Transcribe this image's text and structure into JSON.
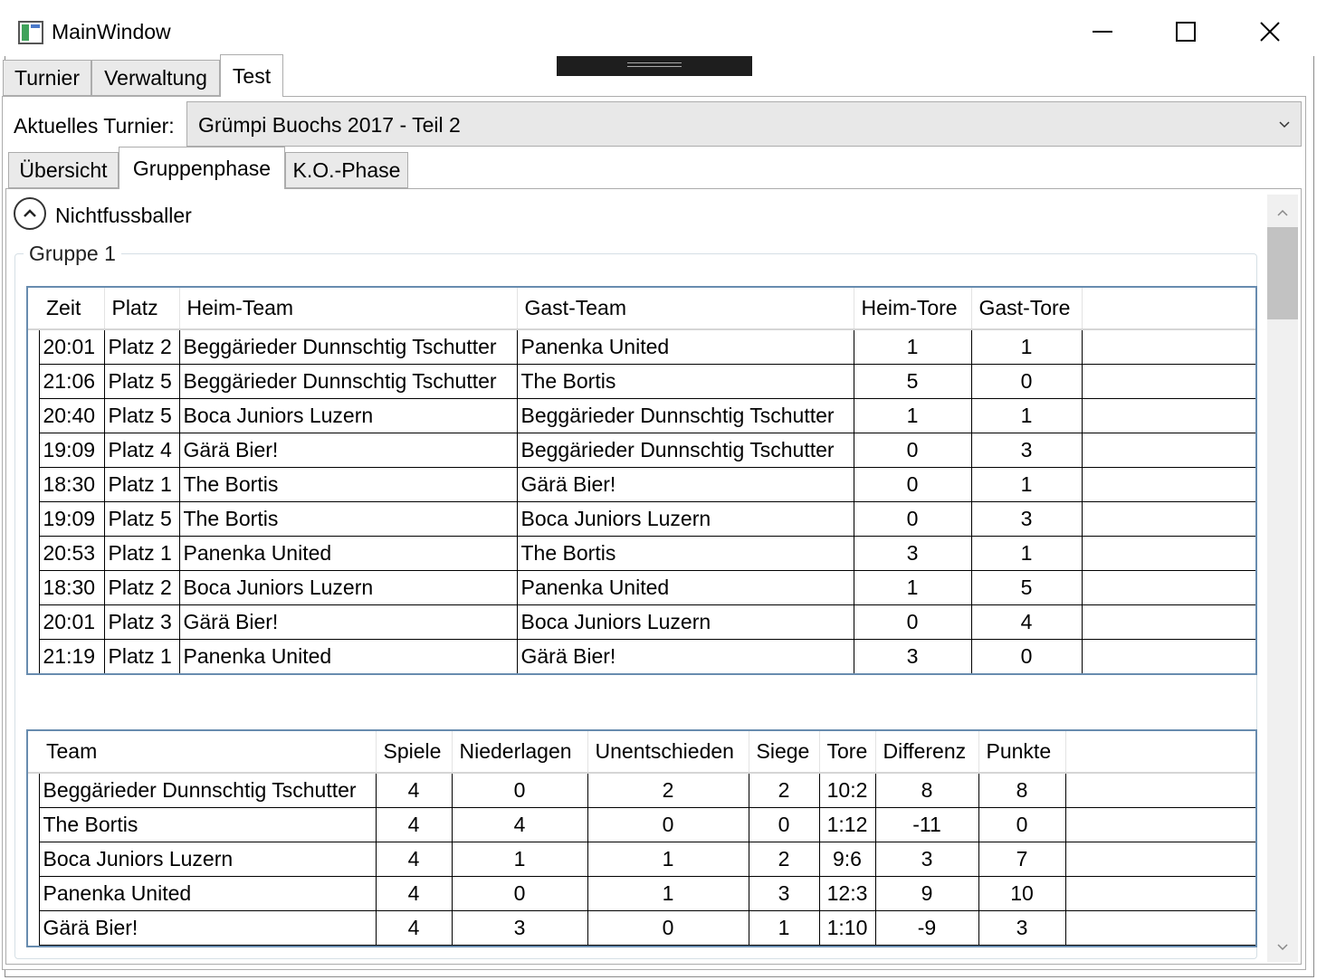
{
  "window": {
    "title": "MainWindow"
  },
  "main_tabs": [
    "Turnier",
    "Verwaltung",
    "Test"
  ],
  "tournament": {
    "label": "Aktuelles Turnier:",
    "selected": "Grümpi Buochs 2017 - Teil 2"
  },
  "sub_tabs": [
    "Übersicht",
    "Gruppenphase",
    "K.O.-Phase"
  ],
  "category": "Nichtfussballer",
  "group": {
    "title": "Gruppe 1",
    "matches": {
      "columns": [
        "Zeit",
        "Platz",
        "Heim-Team",
        "Gast-Team",
        "Heim-Tore",
        "Gast-Tore"
      ],
      "rows": [
        [
          "20:01",
          "Platz 2",
          "Beggärieder Dunnschtig Tschutter",
          "Panenka United",
          "1",
          "1"
        ],
        [
          "21:06",
          "Platz 5",
          "Beggärieder Dunnschtig Tschutter",
          "The Bortis",
          "5",
          "0"
        ],
        [
          "20:40",
          "Platz 5",
          "Boca Juniors Luzern",
          "Beggärieder Dunnschtig Tschutter",
          "1",
          "1"
        ],
        [
          "19:09",
          "Platz 4",
          "Gärä Bier!",
          "Beggärieder Dunnschtig Tschutter",
          "0",
          "3"
        ],
        [
          "18:30",
          "Platz 1",
          "The Bortis",
          "Gärä Bier!",
          "0",
          "1"
        ],
        [
          "19:09",
          "Platz 5",
          "The Bortis",
          "Boca Juniors Luzern",
          "0",
          "3"
        ],
        [
          "20:53",
          "Platz 1",
          "Panenka United",
          "The Bortis",
          "3",
          "1"
        ],
        [
          "18:30",
          "Platz 2",
          "Boca Juniors Luzern",
          "Panenka United",
          "1",
          "5"
        ],
        [
          "20:01",
          "Platz 3",
          "Gärä Bier!",
          "Boca Juniors Luzern",
          "0",
          "4"
        ],
        [
          "21:19",
          "Platz 1",
          "Panenka United",
          "Gärä Bier!",
          "3",
          "0"
        ]
      ]
    },
    "standings": {
      "columns": [
        "Team",
        "Spiele",
        "Niederlagen",
        "Unentschieden",
        "Siege",
        "Tore",
        "Differenz",
        "Punkte"
      ],
      "rows": [
        [
          "Beggärieder Dunnschtig Tschutter",
          "4",
          "0",
          "2",
          "2",
          "10:2",
          "8",
          "8"
        ],
        [
          "The Bortis",
          "4",
          "4",
          "0",
          "0",
          "1:12",
          "-11",
          "0"
        ],
        [
          "Boca Juniors Luzern",
          "4",
          "1",
          "1",
          "2",
          "9:6",
          "3",
          "7"
        ],
        [
          "Panenka United",
          "4",
          "0",
          "1",
          "3",
          "12:3",
          "9",
          "10"
        ],
        [
          "Gärä Bier!",
          "4",
          "3",
          "0",
          "1",
          "1:10",
          "-9",
          "3"
        ]
      ]
    }
  }
}
